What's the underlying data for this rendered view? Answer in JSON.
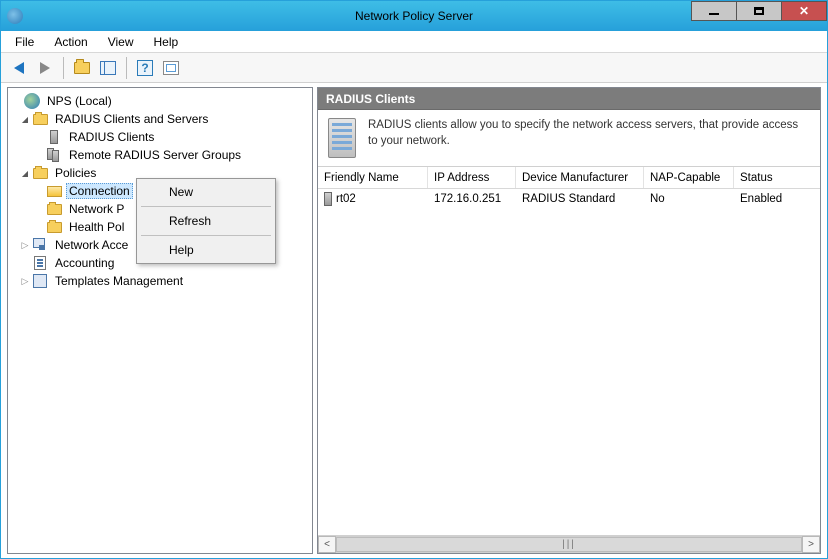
{
  "window": {
    "title": "Network Policy Server"
  },
  "menubar": {
    "file": "File",
    "action": "Action",
    "view": "View",
    "help": "Help"
  },
  "tree": {
    "root": "NPS (Local)",
    "radius_clients_servers": "RADIUS Clients and Servers",
    "radius_clients": "RADIUS Clients",
    "remote_groups": "Remote RADIUS Server Groups",
    "policies": "Policies",
    "connection_req": "Connection Request Policies",
    "connection_req_truncated": "Connection",
    "network_policies": "Network Policies",
    "network_policies_truncated": "Network P",
    "health_policies": "Health Policies",
    "health_policies_truncated": "Health Pol",
    "nap": "Network Access Protection",
    "nap_truncated": "Network Acce",
    "accounting": "Accounting",
    "templates": "Templates Management"
  },
  "context_menu": {
    "new": "New",
    "refresh": "Refresh",
    "help": "Help"
  },
  "detail": {
    "header": "RADIUS Clients",
    "info": "RADIUS clients allow you to specify the network access servers, that provide access to your network.",
    "columns": {
      "friendly_name": "Friendly Name",
      "ip": "IP Address",
      "device": "Device Manufacturer",
      "nap": "NAP-Capable",
      "status": "Status"
    },
    "rows": [
      {
        "name": "rt02",
        "ip": "172.16.0.251",
        "device": "RADIUS Standard",
        "nap": "No",
        "status": "Enabled"
      }
    ]
  }
}
